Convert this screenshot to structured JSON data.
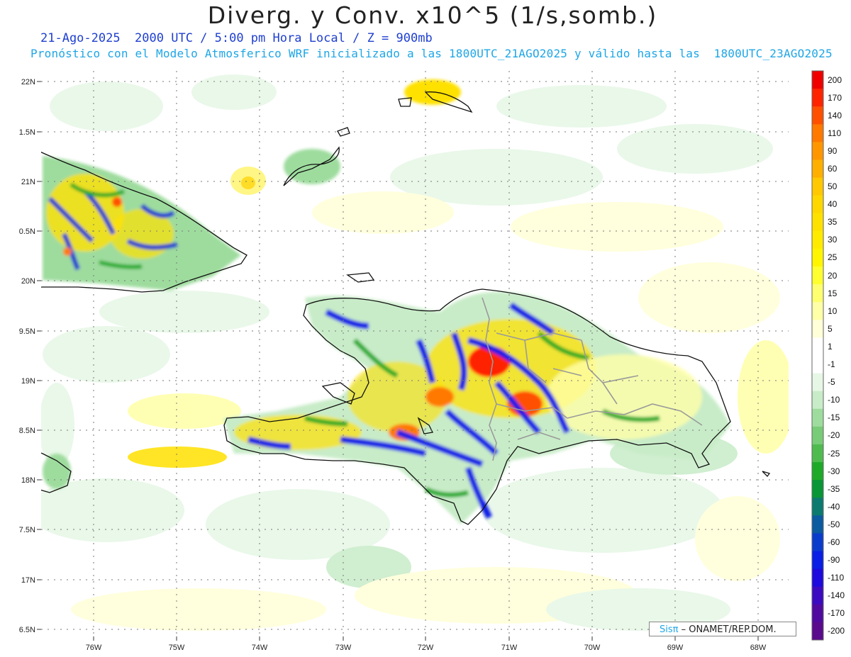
{
  "title": "Diverg. y Conv. x10^5 (1/s,somb.)",
  "subtitle_date": "21-Ago-2025  2000 UTC / 5:00 pm Hora Local / Z = 900mb",
  "subtitle_model": "Pronóstico con el Modelo Atmosferico WRF inicializado a las 1800UTC_21AGO2025 y válido hasta las  1800UTC_23AGO2025",
  "lat_labels": [
    "22N",
    "1.5N",
    "21N",
    "0.5N",
    "20N",
    "9.5N",
    "19N",
    "8.5N",
    "18N",
    "7.5N",
    "17N",
    "6.5N"
  ],
  "lon_labels": [
    "76W",
    "75W",
    "74W",
    "73W",
    "72W",
    "71W",
    "70W",
    "69W",
    "68W"
  ],
  "colorbar": {
    "labels": [
      "200",
      "170",
      "140",
      "110",
      "90",
      "60",
      "50",
      "40",
      "35",
      "30",
      "25",
      "20",
      "15",
      "10",
      "5",
      "1",
      "-1",
      "-5",
      "-10",
      "-15",
      "-20",
      "-25",
      "-30",
      "-35",
      "-40",
      "-50",
      "-60",
      "-90",
      "-110",
      "-140",
      "-170",
      "-200"
    ],
    "colors": [
      "#f00000",
      "#ff2400",
      "#ff5000",
      "#ff7800",
      "#ff9600",
      "#ffaf00",
      "#ffc800",
      "#ffd700",
      "#ffe100",
      "#ffeb00",
      "#fff500",
      "#ffff30",
      "#ffff70",
      "#ffffa8",
      "#ffffd8",
      "#ffffff",
      "#ffffff",
      "#e6f7e6",
      "#c8ecc8",
      "#9edc9e",
      "#78cc78",
      "#4fbb4f",
      "#1eaa28",
      "#089636",
      "#0c7a6e",
      "#0c5aa0",
      "#0a3ccc",
      "#0a1ee6",
      "#1e0adc",
      "#3c0ac0",
      "#500aa0",
      "#5a0a8c"
    ]
  },
  "credit": {
    "sis": "Sisπ",
    "rest": "– ONAMET/REP.DOM."
  }
}
